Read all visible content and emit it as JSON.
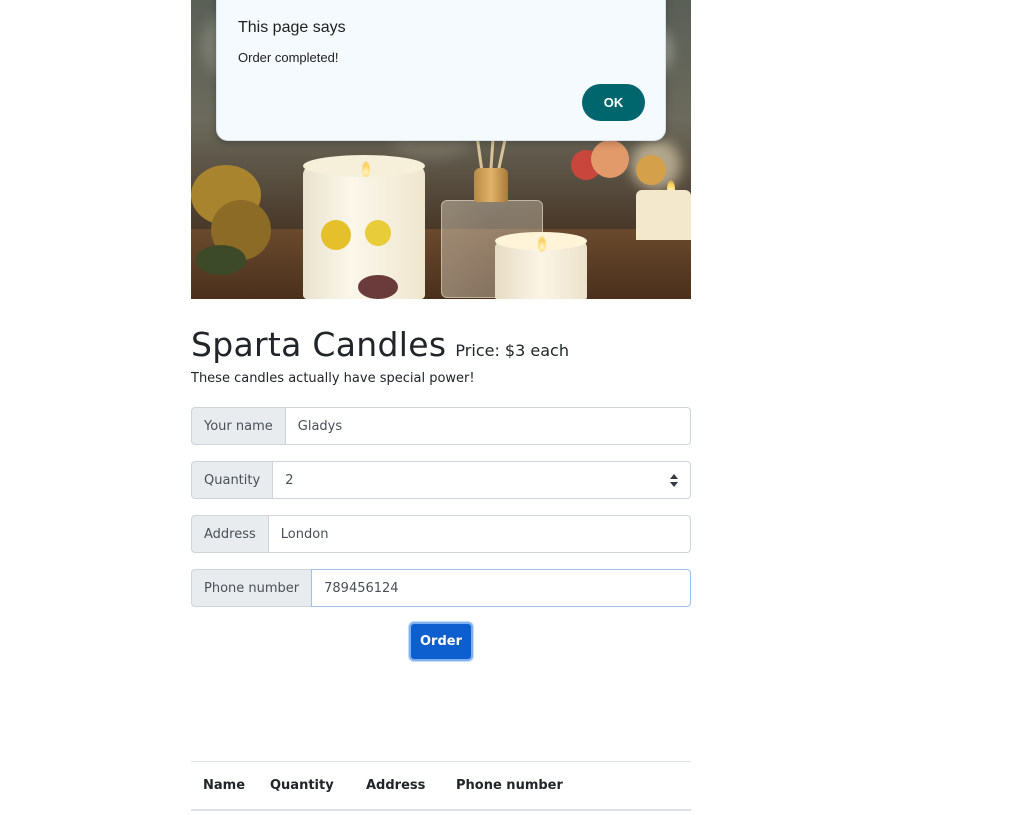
{
  "dialog": {
    "title": "This page says",
    "message": "Order completed!",
    "ok_label": "OK",
    "accent": "#00666e"
  },
  "hero": {
    "alt": "Candles with pressed flowers and a reed diffuser"
  },
  "product": {
    "title": "Sparta Candles",
    "price": "Price: $3 each",
    "description": "These candles actually have special power!"
  },
  "form": {
    "name_label": "Your name",
    "name_value": "Gladys",
    "quantity_label": "Quantity",
    "quantity_value": "2",
    "address_label": "Address",
    "address_value": "London",
    "phone_label": "Phone number",
    "phone_value": "789456124",
    "order_label": "Order",
    "order_color": "#0d5fd0"
  },
  "table": {
    "headers": [
      "Name",
      "Quantity",
      "Address",
      "Phone number"
    ]
  }
}
